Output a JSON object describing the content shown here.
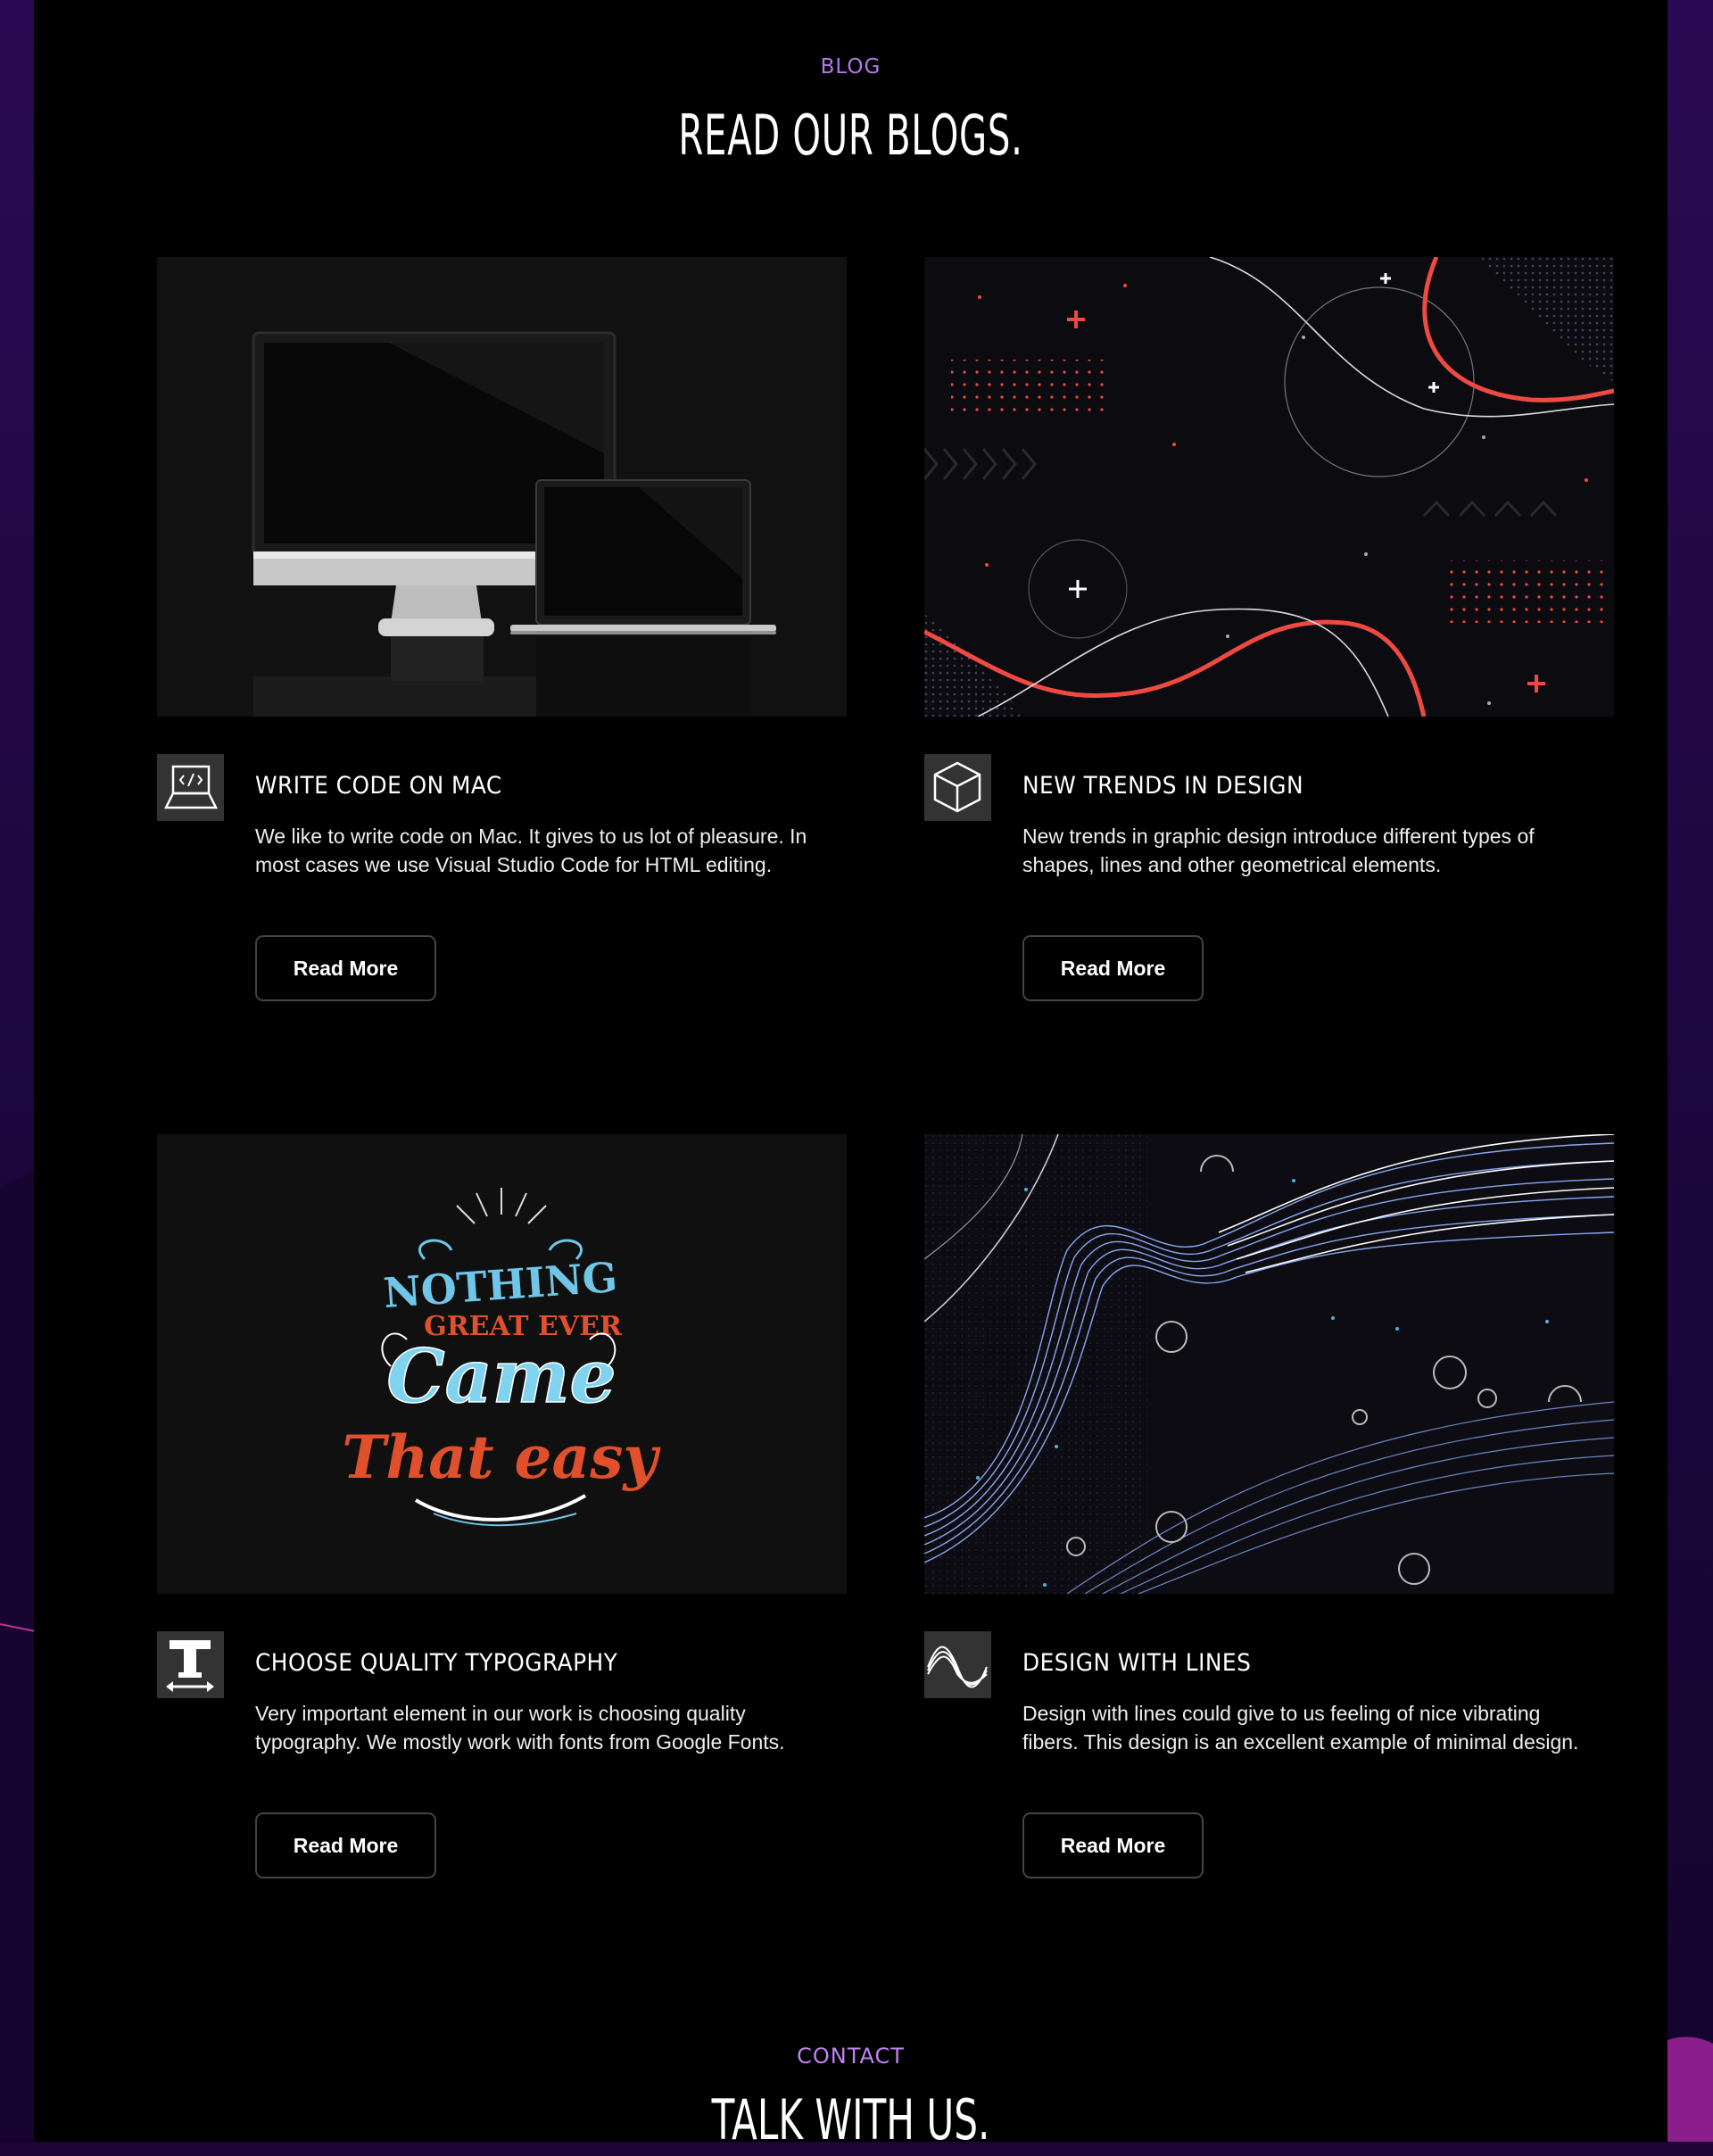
{
  "blog": {
    "label": "BLOG",
    "title": "READ OUR BLOGS.",
    "posts": [
      {
        "title": "WRITE CODE ON MAC",
        "text": "We like to write code on Mac. It gives to us lot of pleasure. In most cases we use Visual Studio Code for HTML editing.",
        "button": "Read More",
        "icon": "laptop-code-icon",
        "image": "mac-devices-image"
      },
      {
        "title": "NEW TRENDS IN DESIGN",
        "text": "New trends in graphic design introduce different types of shapes, lines and other geometrical elements.",
        "button": "Read More",
        "icon": "cube-icon",
        "image": "geometric-shapes-image"
      },
      {
        "title": "CHOOSE QUALITY TYPOGRAPHY",
        "text": "Very important element in our work is choosing quality typography. We mostly work with fonts from Google Fonts.",
        "button": "Read More",
        "icon": "typography-icon",
        "image": "typography-poster-image",
        "poster_text": [
          "NOTHING",
          "GREAT EVER",
          "Came",
          "That easy"
        ]
      },
      {
        "title": "DESIGN WITH LINES",
        "text": "Design with lines could give to us feeling of nice vibrating fibers. This design is an excellent example of minimal design.",
        "button": "Read More",
        "icon": "wave-lines-icon",
        "image": "wave-lines-image"
      }
    ]
  },
  "contact": {
    "label": "CONTACT",
    "title": "TALK WITH US."
  },
  "colors": {
    "accent_purple": "#b07ae8",
    "background": "#000000",
    "side_background": "#2a0a52",
    "coral": "#ef4a42",
    "line_blue": "#8aa8f0"
  }
}
